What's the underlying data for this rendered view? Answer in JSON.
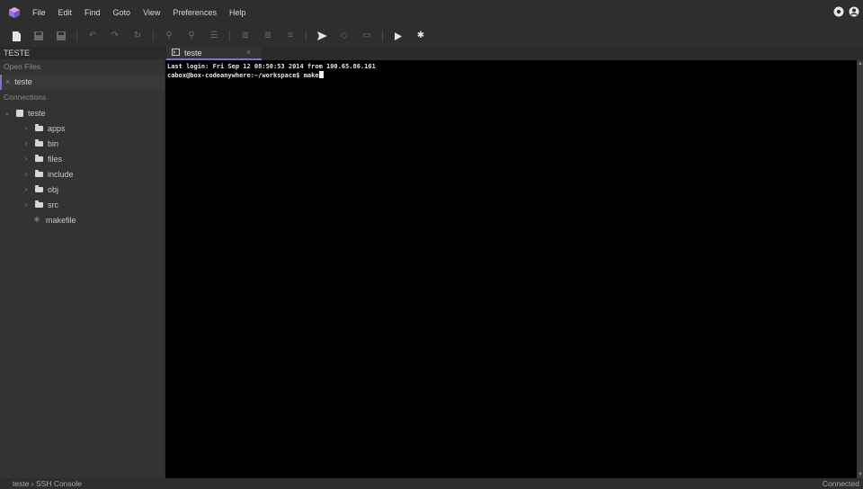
{
  "menu": {
    "items": [
      "File",
      "Edit",
      "Find",
      "Goto",
      "View",
      "Preferences",
      "Help"
    ]
  },
  "icons": {
    "logo": "cube-logo-icon",
    "account": "account-icon",
    "accent": "#8b6bc7"
  },
  "sidebar": {
    "project": "TESTE",
    "open_files_label": "Open Files",
    "open_file": "teste",
    "open_file_close": "×",
    "connections_label": "Connections",
    "root": "teste",
    "folders": [
      "apps",
      "bin",
      "files",
      "include",
      "obj",
      "src"
    ],
    "file": "makefile",
    "chevron_right": "›",
    "chevron_down": "⌄"
  },
  "tab": {
    "label": "teste",
    "close": "×"
  },
  "terminal": {
    "lines": [
      "Last login: Fri Sep 12 08:50:53 2014 from 100.65.86.161",
      "cabox@box-codeanywhere:~/workspace$ make"
    ]
  },
  "status": {
    "breadcrumb": "teste › SSH Console",
    "connection": "Connected"
  }
}
